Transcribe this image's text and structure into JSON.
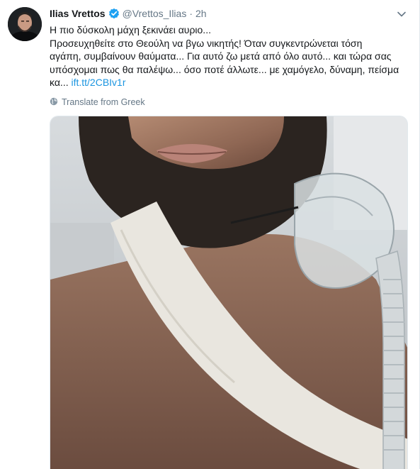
{
  "tweet": {
    "author_name": "Ilias Vrettos",
    "handle": "@Vrettos_Ilias",
    "separator": "·",
    "time": "2h",
    "verified_icon": "verified-badge-icon",
    "caret_icon": "chevron-down-icon",
    "text_lines": [
      "Η πιο δύσκολη μάχη ξεκινάει αυριο...",
      "Προσευχηθείτε στο Θεούλη να βγω νικητής! Όταν συγκεντρώνεται τόση",
      "αγάπη, συμβαίνουν θαύματα... Για αυτό ζω μετά από όλο αυτό... και τώρα σας",
      "υπόσχομαι πως θα παλέψω... όσο ποτέ άλλωτε... με χαμόγελο, δύναμη, πείσμα",
      "κα..."
    ],
    "link_text": "ift.tt/2CBIv1r",
    "translate_label": "Translate from Greek",
    "translate_icon": "globe-icon",
    "media_description_icon": "photo-icon"
  },
  "colors": {
    "text": "#14171a",
    "secondary": "#657786",
    "link": "#1b95e0",
    "verified": "#1da1f2",
    "border": "#e1e8ed"
  }
}
